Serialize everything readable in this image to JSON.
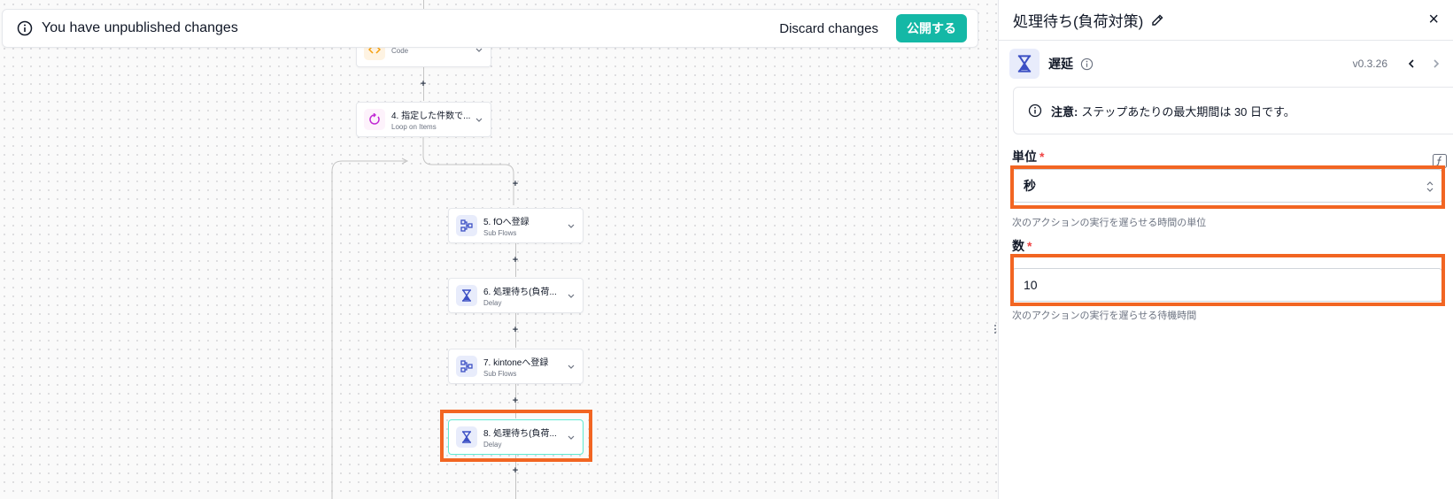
{
  "banner": {
    "message": "You have unpublished changes",
    "discard_label": "Discard changes",
    "publish_label": "公開する"
  },
  "flow": {
    "nodes": [
      {
        "title": "",
        "subtitle": "Code",
        "icon": "code-icon"
      },
      {
        "title": "4. 指定した件数で...",
        "subtitle": "Loop on Items",
        "icon": "loop-icon"
      },
      {
        "title": "5. fOへ登録",
        "subtitle": "Sub Flows",
        "icon": "subflow-icon"
      },
      {
        "title": "6. 処理待ち(負荷...",
        "subtitle": "Delay",
        "icon": "hourglass-icon"
      },
      {
        "title": "7. kintoneへ登録",
        "subtitle": "Sub Flows",
        "icon": "subflow-icon"
      },
      {
        "title": "8. 処理待ち(負荷...",
        "subtitle": "Delay",
        "icon": "hourglass-icon"
      }
    ],
    "plus_label": "+"
  },
  "panel": {
    "title": "処理待ち(負荷対策)",
    "close_label": "×",
    "action_name": "遅延",
    "version": "v0.3.26",
    "notice_label": "注意:",
    "notice_text": "ステップあたりの最大期間は 30 日です。",
    "unit_label": "単位",
    "unit_value": "秒",
    "unit_help": "次のアクションの実行を遅らせる時間の単位",
    "count_label": "数",
    "count_value": "10",
    "count_help": "次のアクションの実行を遅らせる待機時間",
    "required_mark": "*"
  },
  "colors": {
    "accent": "#14b8a6",
    "highlight": "#f26522",
    "icon_blue": "#3b4fc4"
  }
}
